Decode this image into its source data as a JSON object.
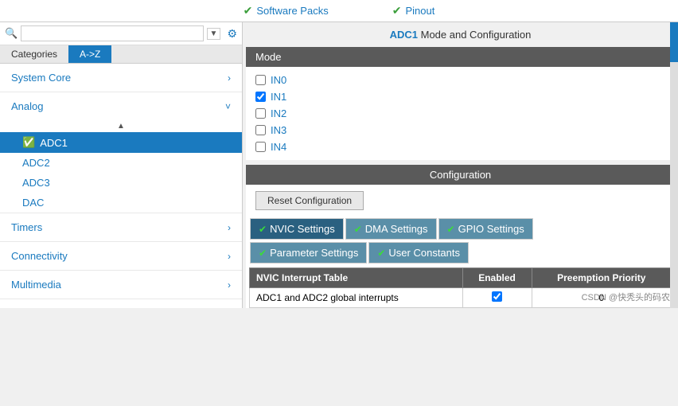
{
  "topbar": {
    "software_packs_label": "Software Packs",
    "pinout_label": "Pinout",
    "check_icon": "✔"
  },
  "sidebar": {
    "search_placeholder": "",
    "tabs": [
      {
        "id": "categories",
        "label": "Categories",
        "active": false
      },
      {
        "id": "a-z",
        "label": "A->Z",
        "active": true
      }
    ],
    "categories": [
      {
        "id": "system-core",
        "label": "System Core",
        "expanded": false
      },
      {
        "id": "analog",
        "label": "Analog",
        "expanded": true
      },
      {
        "id": "timers",
        "label": "Timers",
        "expanded": false
      },
      {
        "id": "connectivity",
        "label": "Connectivity",
        "expanded": false
      },
      {
        "id": "multimedia",
        "label": "Multimedia",
        "expanded": false
      }
    ],
    "analog_items": [
      {
        "id": "adc1",
        "label": "ADC1",
        "active": true,
        "checked": true
      },
      {
        "id": "adc2",
        "label": "ADC2",
        "active": false,
        "checked": false
      },
      {
        "id": "adc3",
        "label": "ADC3",
        "active": false,
        "checked": false
      },
      {
        "id": "dac",
        "label": "DAC",
        "active": false,
        "checked": false
      }
    ]
  },
  "content": {
    "title_prefix": "ADC1",
    "title_suffix": " Mode and Configuration",
    "mode_section_label": "Mode",
    "mode_items": [
      {
        "id": "in0",
        "label": "IN0",
        "checked": false
      },
      {
        "id": "in1",
        "label": "IN1",
        "checked": true
      },
      {
        "id": "in2",
        "label": "IN2",
        "checked": false
      },
      {
        "id": "in3",
        "label": "IN3",
        "checked": false
      },
      {
        "id": "in4",
        "label": "IN4",
        "checked": false
      }
    ],
    "config_section_label": "Configuration",
    "reset_btn_label": "Reset Configuration",
    "tabs": [
      {
        "id": "nvic",
        "label": "NVIC Settings",
        "active": true
      },
      {
        "id": "dma",
        "label": "DMA Settings",
        "active": false
      },
      {
        "id": "gpio",
        "label": "GPIO Settings",
        "active": false
      }
    ],
    "tabs2": [
      {
        "id": "param",
        "label": "Parameter Settings",
        "active": false
      },
      {
        "id": "user",
        "label": "User Constants",
        "active": false
      }
    ],
    "nvic_table": {
      "headers": [
        "NVIC Interrupt Table",
        "Enabled",
        "Preemption Priority"
      ],
      "rows": [
        {
          "name": "ADC1 and ADC2 global interrupts",
          "enabled": true,
          "priority": "0"
        }
      ]
    }
  },
  "watermark": "CSDN @快秃头的码农"
}
